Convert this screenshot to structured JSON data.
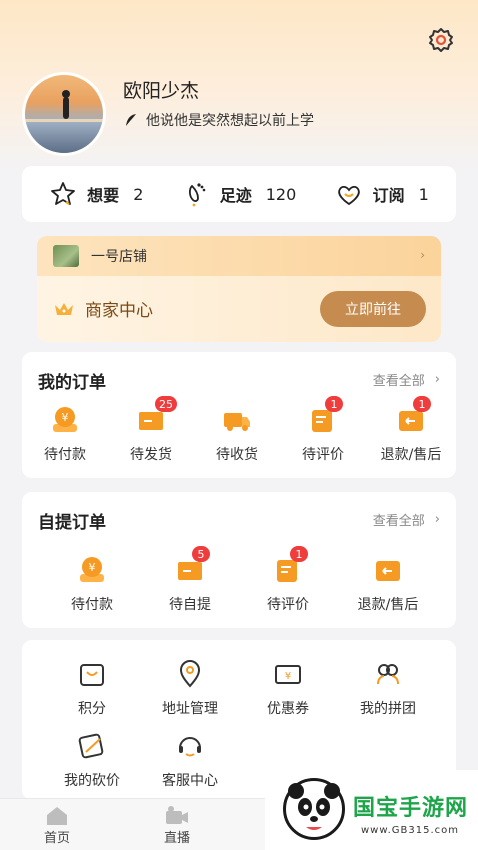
{
  "profile": {
    "name": "欧阳少杰",
    "signature": "他说他是突然想起以前上学"
  },
  "stats": [
    {
      "label": "想要",
      "value": "2",
      "icon": "star-icon"
    },
    {
      "label": "足迹",
      "value": "120",
      "icon": "footprint-icon"
    },
    {
      "label": "订阅",
      "value": "1",
      "icon": "heart-icon"
    }
  ],
  "shop": {
    "name": "一号店铺",
    "merchant_label": "商家中心",
    "go_button": "立即前往"
  },
  "my_orders": {
    "title": "我的订单",
    "view_all": "查看全部",
    "items": [
      {
        "label": "待付款",
        "badge": ""
      },
      {
        "label": "待发货",
        "badge": "25"
      },
      {
        "label": "待收货",
        "badge": ""
      },
      {
        "label": "待评价",
        "badge": "1"
      },
      {
        "label": "退款/售后",
        "badge": "1"
      }
    ]
  },
  "pickup_orders": {
    "title": "自提订单",
    "view_all": "查看全部",
    "items": [
      {
        "label": "待付款",
        "badge": ""
      },
      {
        "label": "待自提",
        "badge": "5"
      },
      {
        "label": "待评价",
        "badge": "1"
      },
      {
        "label": "退款/售后",
        "badge": ""
      }
    ]
  },
  "tools": [
    {
      "label": "积分",
      "icon": "points-icon"
    },
    {
      "label": "地址管理",
      "icon": "location-icon"
    },
    {
      "label": "优惠券",
      "icon": "coupon-icon"
    },
    {
      "label": "我的拼团",
      "icon": "group-buy-icon"
    },
    {
      "label": "我的砍价",
      "icon": "bargain-icon"
    },
    {
      "label": "客服中心",
      "icon": "customer-service-icon"
    }
  ],
  "tabbar": [
    {
      "label": "首页",
      "icon": "home-icon"
    },
    {
      "label": "直播",
      "icon": "live-icon"
    }
  ],
  "watermark": {
    "text": "国宝手游网",
    "url": "www.GB315.com"
  },
  "colors": {
    "accent": "#c58b4f",
    "badge": "#ef3c3c",
    "orange_icon": "#f59a23"
  }
}
